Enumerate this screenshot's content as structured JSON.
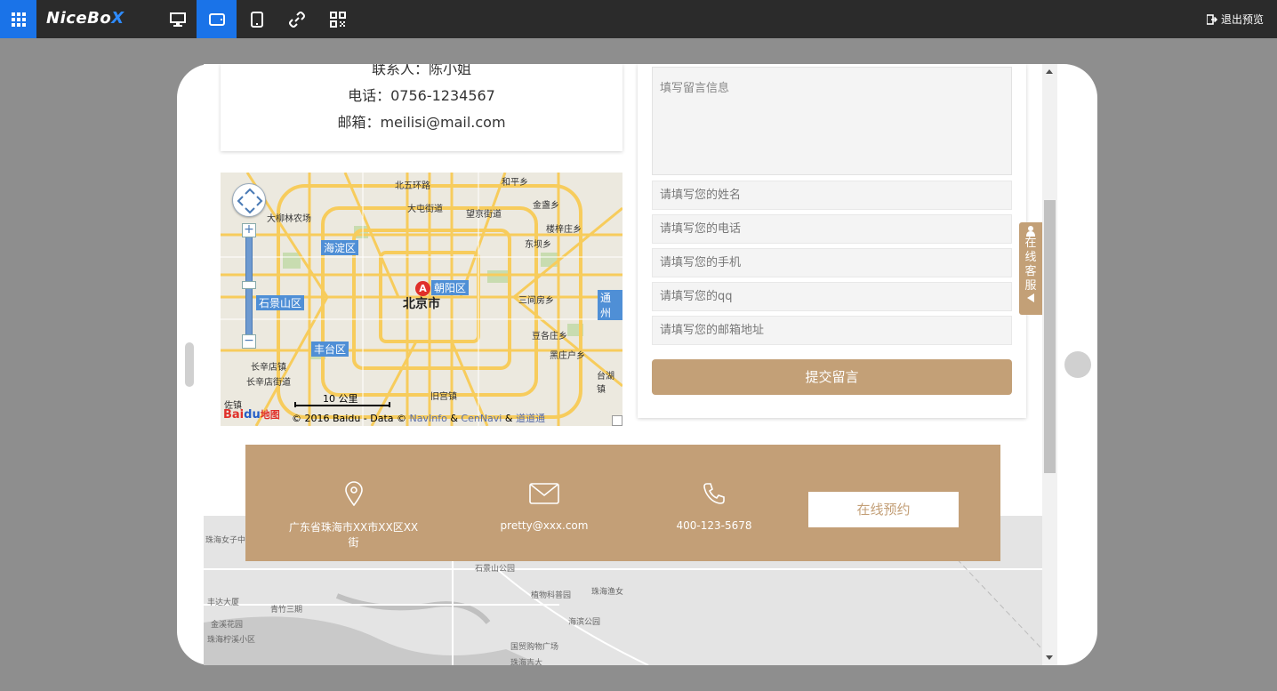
{
  "topbar": {
    "logo_main": "NiceBo",
    "logo_accent": "X",
    "exit_label": "退出预览",
    "devices": [
      "desktop-icon",
      "tablet-landscape-icon",
      "tablet-portrait-icon",
      "link-icon",
      "qrcode-icon"
    ],
    "active_device": "tablet-landscape-icon",
    "accent_color": "#1a73e8"
  },
  "contact": {
    "person": "联系人：陈小姐",
    "phone": "电话：0756-1234567",
    "email": "邮箱：meilisi@mail.com"
  },
  "map": {
    "city_label": "北京市",
    "marker": "A",
    "districts": [
      "海淀区",
      "朝阳区",
      "石景山区",
      "丰台区",
      "通州"
    ],
    "places": [
      "北五环路",
      "和平乡",
      "大屯街道",
      "望京街道",
      "金盏乡",
      "大柳林农场",
      "楼梓庄乡",
      "东坝乡",
      "三间房乡",
      "豆各庄乡",
      "黑庄户乡",
      "长辛店镇",
      "长辛店街道",
      "台湖镇",
      "旧宫镇",
      "佐镇"
    ],
    "scale": "10 公里",
    "copyright": "© 2016 Baidu - Data © ",
    "providers": [
      "NavInfo",
      "CenNavi",
      "道道通"
    ],
    "amp": "&",
    "logo_bai": "Bai",
    "logo_du": "du",
    "logo_map": "地图"
  },
  "form": {
    "message_placeholder": "填写留言信息",
    "name_placeholder": "请填写您的姓名",
    "tel_placeholder": "请填写您的电话",
    "mobile_placeholder": "请填写您的手机",
    "qq_placeholder": "请填写您的qq",
    "email_placeholder": "请填写您的邮箱地址",
    "submit_label": "提交留言"
  },
  "chat": {
    "chars": [
      "在",
      "线",
      "客",
      "服"
    ]
  },
  "footer": {
    "address": "广东省珠海市XX市XX区XX街",
    "email": "pretty@xxx.com",
    "phone": "400-123-5678",
    "book_label": "在线预约",
    "color": "#c39f77"
  },
  "bg_map": {
    "labels": [
      "珠海女子中学",
      "丰达大厦",
      "金溪花园",
      "珠海柠溪小区",
      "青竹三期",
      "石景山公园",
      "植物科普园",
      "珠海渔女",
      "海滨公园",
      "国贸购物广场",
      "珠海吉大"
    ]
  }
}
